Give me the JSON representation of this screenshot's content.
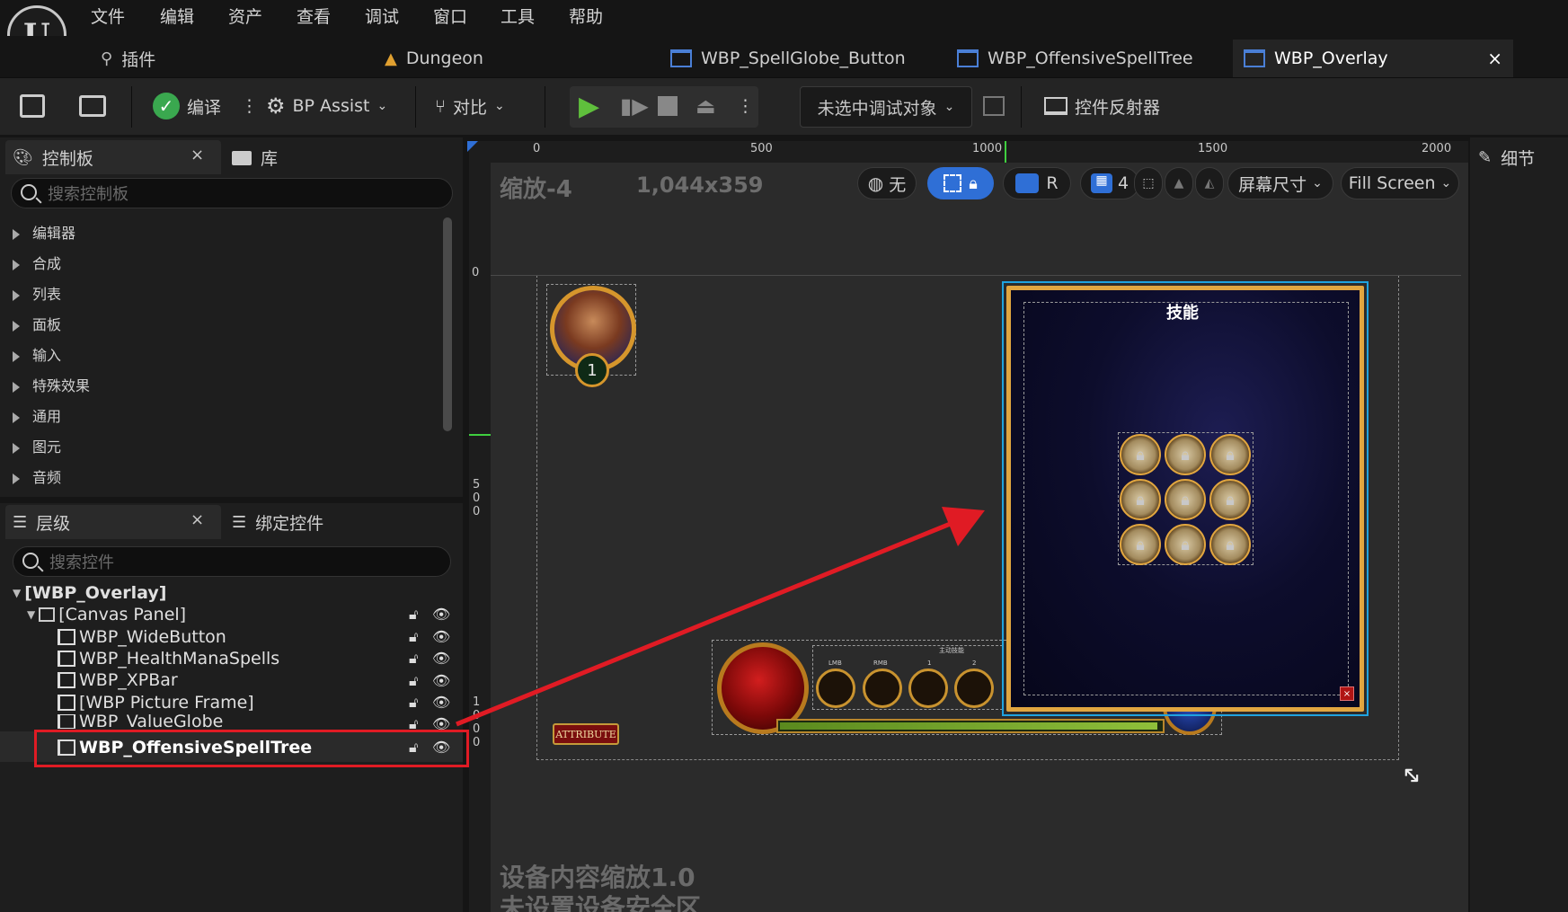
{
  "menu": {
    "items": [
      "文件",
      "编辑",
      "资产",
      "查看",
      "调试",
      "窗口",
      "工具",
      "帮助"
    ]
  },
  "logo": {
    "text": "U"
  },
  "tabs": {
    "plugin": "插件",
    "items": [
      {
        "label": "Dungeon",
        "icon": "level-icon"
      },
      {
        "label": "WBP_SpellGlobe_Button",
        "icon": "widget-blueprint-icon"
      },
      {
        "label": "WBP_OffensiveSpellTree",
        "icon": "widget-blueprint-icon"
      },
      {
        "label": "WBP_Overlay",
        "icon": "widget-blueprint-icon",
        "active": true
      }
    ],
    "close": "×"
  },
  "toolbar": {
    "compile": "编译",
    "bp_assist": "BP Assist",
    "diff": "对比",
    "debug_target": "未选中调试对象",
    "widget_reflector": "控件反射器"
  },
  "palette": {
    "title": "控制板",
    "library": "库",
    "search_placeholder": "搜索控制板",
    "categories": [
      "编辑器",
      "合成",
      "列表",
      "面板",
      "输入",
      "特殊效果",
      "通用",
      "图元",
      "音频"
    ]
  },
  "hierarchy": {
    "title": "层级",
    "bind_tab": "绑定控件",
    "search_placeholder": "搜索控件",
    "root": "[WBP_Overlay]",
    "canvas": "[Canvas Panel]",
    "items": [
      "WBP_WideButton",
      "WBP_HealthManaSpells",
      "WBP_XPBar",
      "[WBP Picture Frame]",
      "WBP_ValueGlobe",
      "WBP_OffensiveSpellTree"
    ],
    "selected_index": 5
  },
  "details": {
    "title": "细节"
  },
  "viewport": {
    "zoom": "缩放-4",
    "resolution": "1,044x359",
    "world_label": "无",
    "r_label": "R",
    "grid_value": "4",
    "screen_size": "屏幕尺寸",
    "fill_screen": "Fill Screen",
    "ruler_top": [
      "0",
      "500",
      "1000",
      "1500",
      "2000"
    ],
    "ruler_left": [
      "0",
      "5\n0\n0",
      "1\n0\n0\n0"
    ],
    "footer_line1": "设备内容缩放1.0",
    "footer_line2": "未设置设备安全区"
  },
  "canvas_widgets": {
    "skill_title": "技能",
    "level": "1",
    "attribute": "ATTRIBUTE",
    "spell_labels": [
      "主动技能",
      "LMB",
      "RMB",
      "1",
      "2"
    ]
  },
  "colors": {
    "accent_blue": "#2f6fd6",
    "play_green": "#5fbf3c",
    "selection_red": "#e01b24",
    "frame_gold": "#e1a640"
  }
}
